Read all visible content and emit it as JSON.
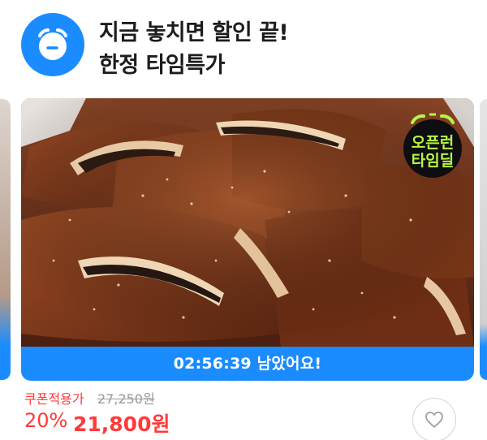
{
  "header": {
    "title_line1": "지금 놓치면 할인 끝!",
    "title_line2": "한정 타임특가",
    "icon": "alarm-clock-icon",
    "accent": "#1a8cff"
  },
  "product": {
    "image": "grilled-galbi-photo",
    "badge_line1": "오픈런",
    "badge_line2": "타임딜",
    "badge_icon": "alarm-clock-icon",
    "badge_text_color": "#b6f542",
    "timer_text": "02:56:39 남았어요!",
    "price_label": "쿠폰적용가",
    "original_price": "27,250원",
    "discount": "20%",
    "sale_price": "21,800원",
    "price_color": "#ff3a3a",
    "like_icon": "heart-outline-icon"
  }
}
